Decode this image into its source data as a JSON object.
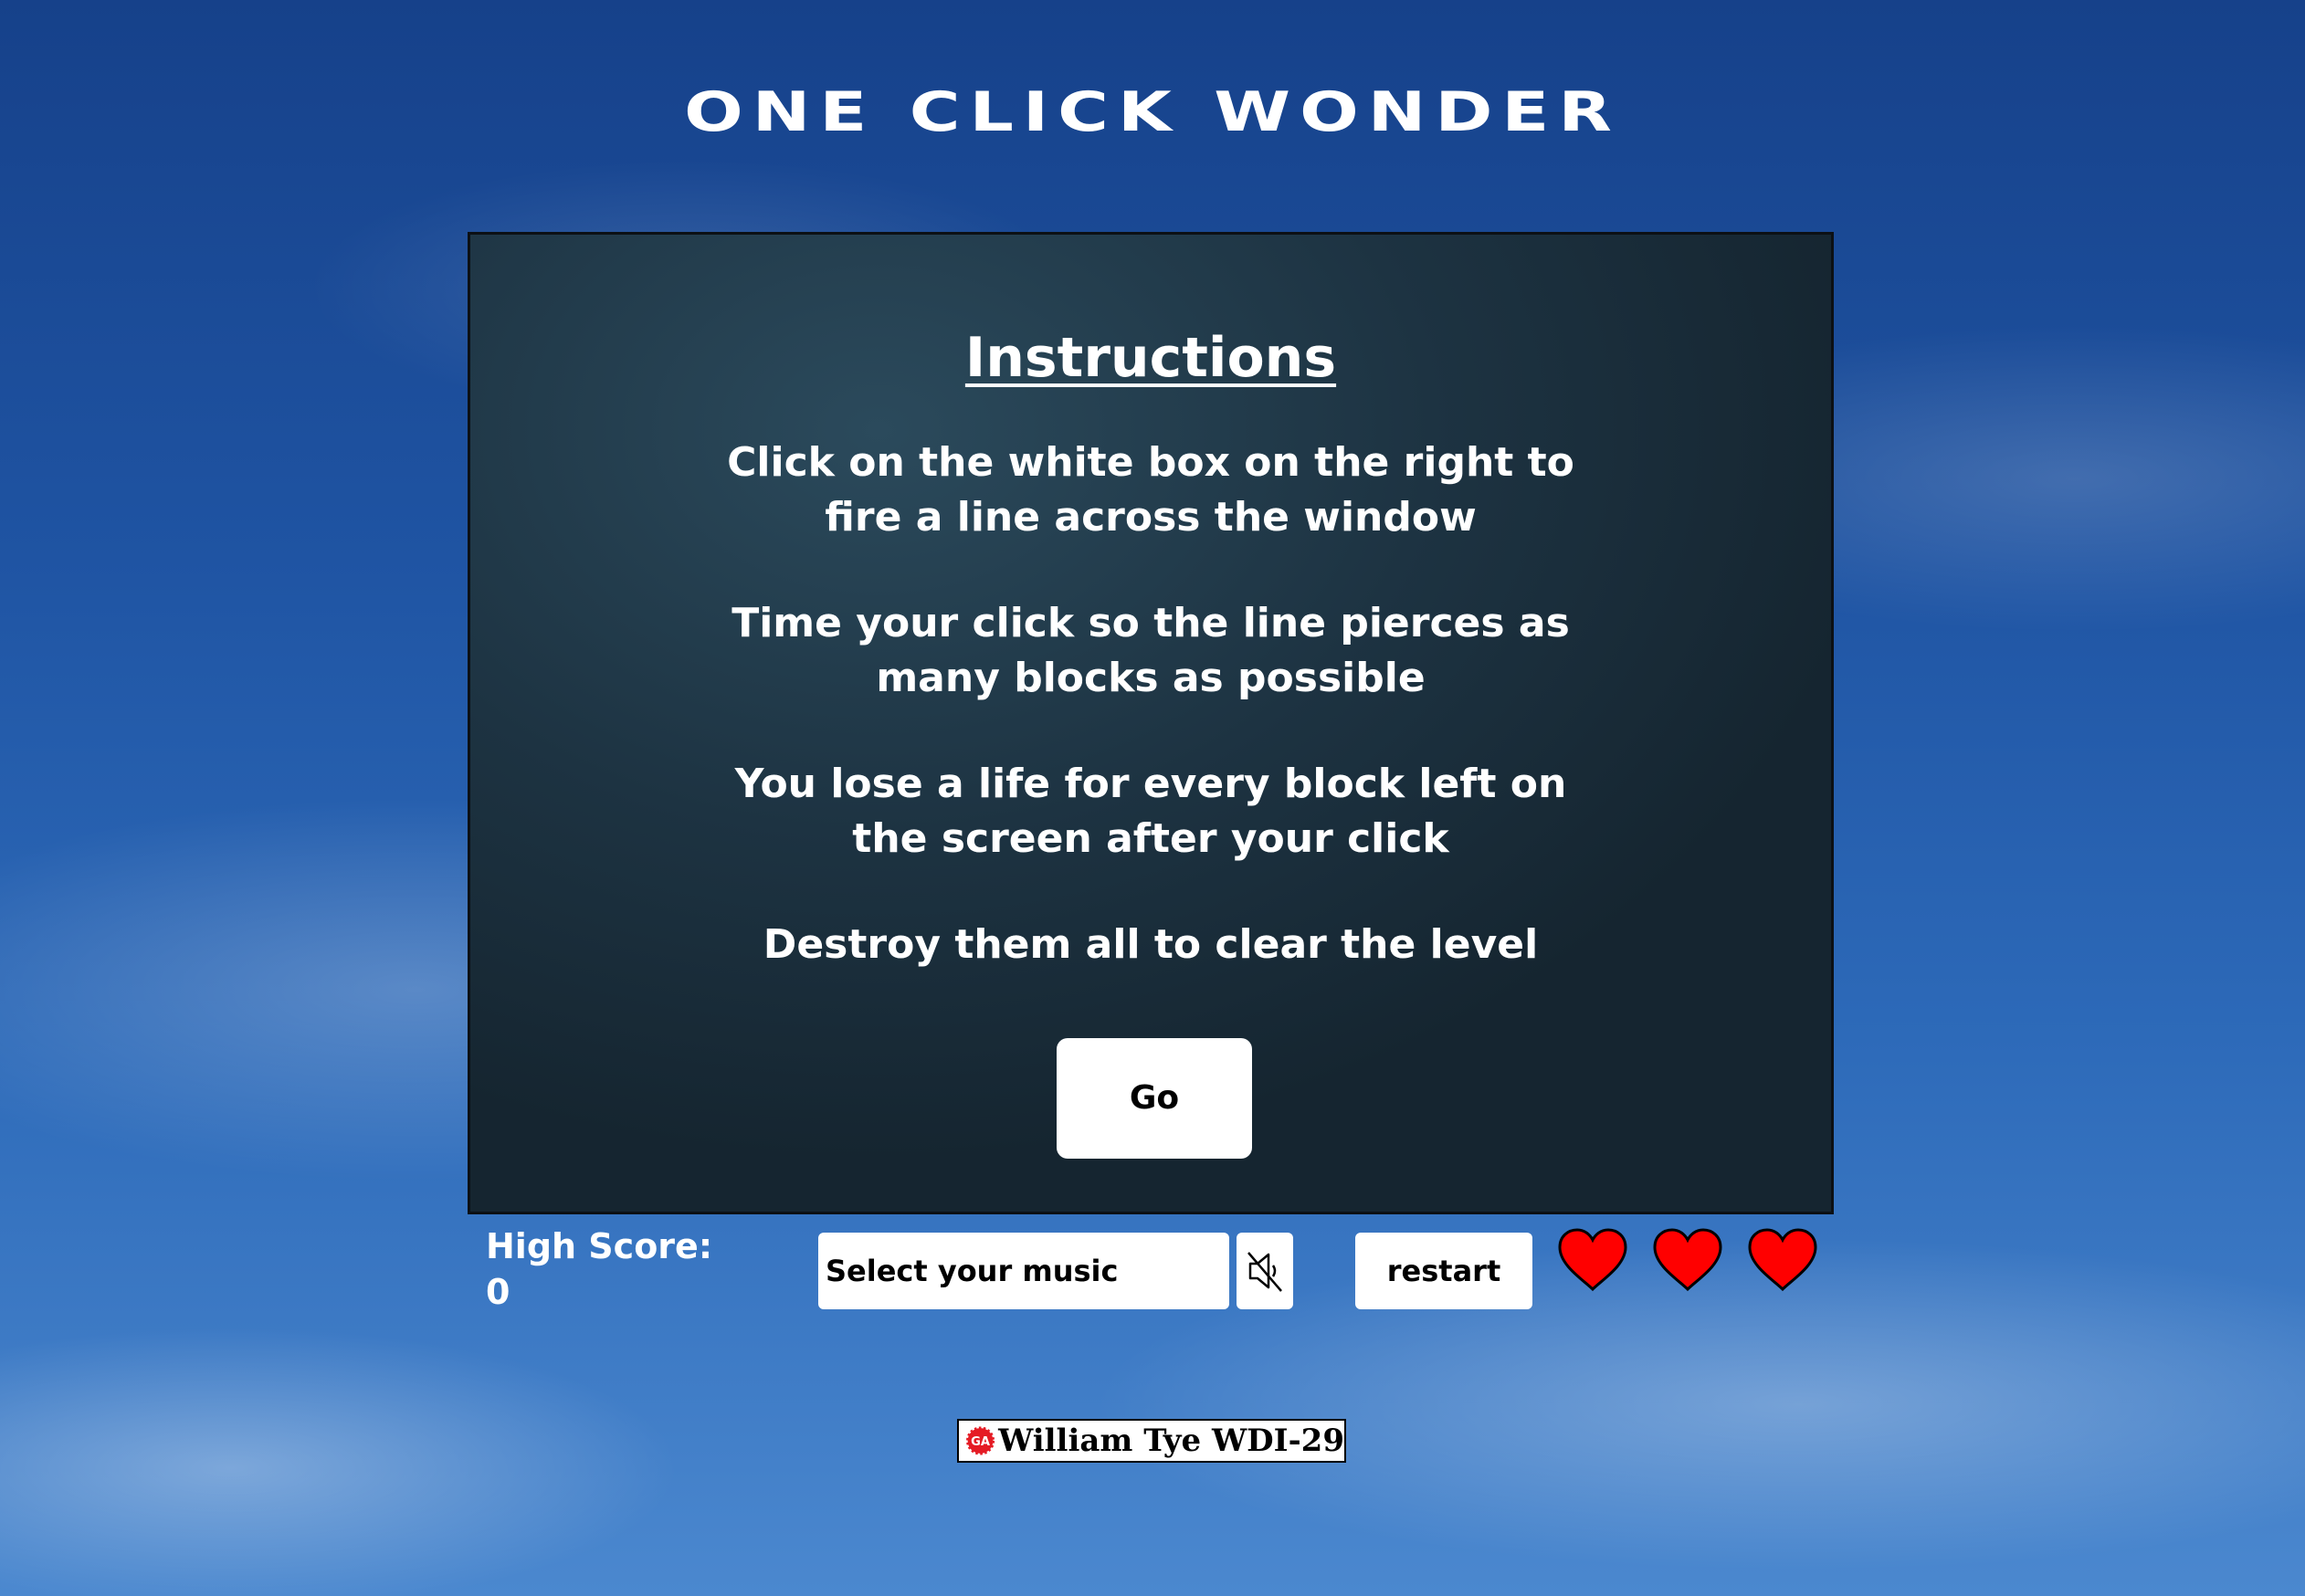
{
  "game": {
    "title": "ONE CLICK WONDER"
  },
  "instructions": {
    "heading": "Instructions",
    "paragraphs": [
      "Click on the white box on the right to fire a line across the window",
      "Time your click so the line pierces as many blocks as possible",
      "You lose a life for every block left on the screen after your click",
      "Destroy them all to clear the level"
    ],
    "go_label": "Go"
  },
  "controls": {
    "high_score_label": "High Score:",
    "high_score_value": "0",
    "music_select_value": "Select your music",
    "mute_icon": "speaker-muted-icon",
    "restart_label": "restart",
    "lives": 3,
    "heart_icon": "heart-icon",
    "heart_color": "#ff0000"
  },
  "footer": {
    "logo_text": "GA",
    "logo_color": "#e51b24",
    "credit": "William Tye WDI-29"
  }
}
